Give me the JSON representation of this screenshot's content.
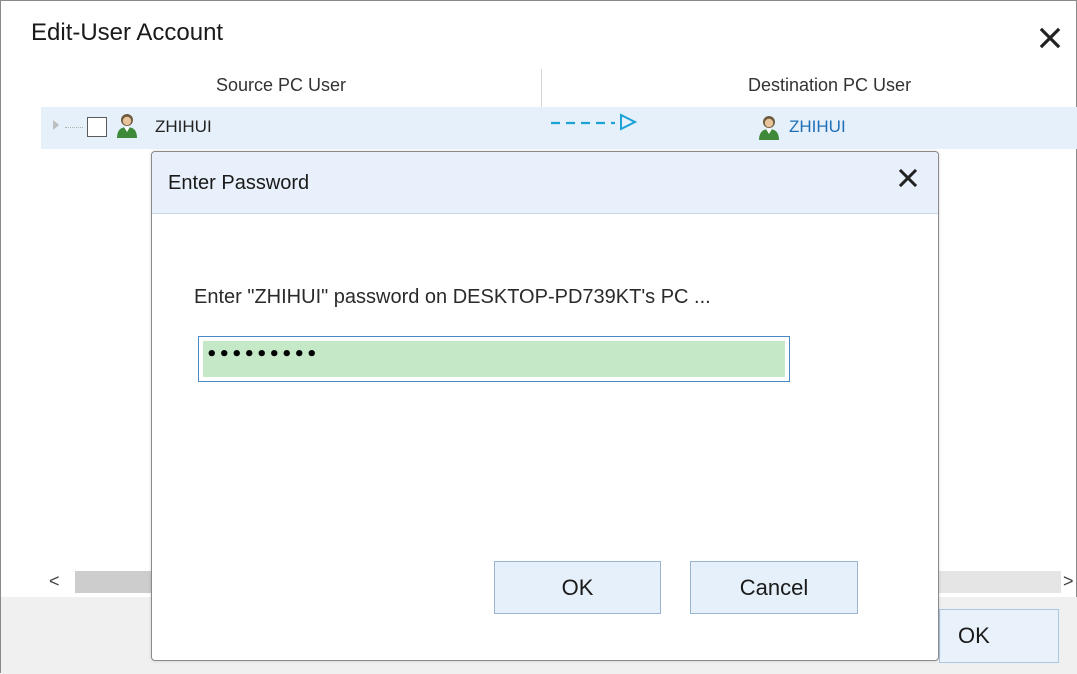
{
  "window": {
    "title": "Edit-User Account",
    "close_icon": "close-icon"
  },
  "columns": {
    "source": "Source PC User",
    "destination": "Destination PC User"
  },
  "user_row": {
    "source_name": "ZHIHUI",
    "destination_name": "ZHIHUI",
    "checked": false
  },
  "footer": {
    "ok_label": "OK"
  },
  "scroll": {
    "left_arrow": "<",
    "right_arrow": ">"
  },
  "dialog": {
    "title": "Enter Password",
    "prompt": "Enter \"ZHIHUI\" password on DESKTOP-PD739KT's PC ...",
    "password_value": "•••••••••",
    "ok_label": "OK",
    "cancel_label": "Cancel"
  },
  "colors": {
    "row_highlight": "#e6f0fb",
    "dialog_header": "#e8f1fb",
    "password_fill": "#c5e8c6",
    "link_blue": "#1f6fb6",
    "arrow_cyan": "#1ba3d6"
  }
}
